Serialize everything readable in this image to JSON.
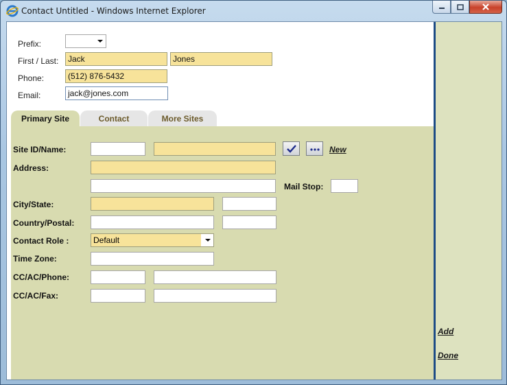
{
  "window": {
    "title": "Contact Untitled - Windows Internet Explorer"
  },
  "header": {
    "prefix_label": "Prefix:",
    "prefix_value": "",
    "first_last_label": "First / Last:",
    "first_name": "Jack",
    "last_name": "Jones",
    "phone_label": "Phone:",
    "phone": "(512) 876-5432",
    "email_label": "Email:",
    "email": "jack@jones.com"
  },
  "tabs": [
    {
      "label": "Primary Site",
      "active": true
    },
    {
      "label": "Contact",
      "active": false
    },
    {
      "label": "More Sites",
      "active": false
    }
  ],
  "form": {
    "site_label": "Site ID/Name:",
    "site_id": "",
    "site_name": "",
    "new_link": "New",
    "address_label": "Address:",
    "address1": "",
    "address2": "",
    "mailstop_label": "Mail Stop:",
    "mailstop": "",
    "city_state_label": "City/State:",
    "city": "",
    "state": "",
    "country_postal_label": "Country/Postal:",
    "country": "",
    "postal": "",
    "contact_role_label": "Contact Role :",
    "contact_role": "Default",
    "timezone_label": "Time Zone:",
    "timezone": "",
    "phone_label": "CC/AC/Phone:",
    "phone_cc": "",
    "phone_num": "",
    "fax_label": "CC/AC/Fax:",
    "fax_cc": "",
    "fax_num": ""
  },
  "sidebar": {
    "add_link": "Add",
    "done_link": "Done"
  },
  "icons": {
    "check": "check-icon",
    "browse": "ellipsis-icon",
    "app": "ie-icon"
  },
  "colors": {
    "required_field": "#f7e39a",
    "panel": "#d8dbb0",
    "divider": "#1d4c86"
  }
}
